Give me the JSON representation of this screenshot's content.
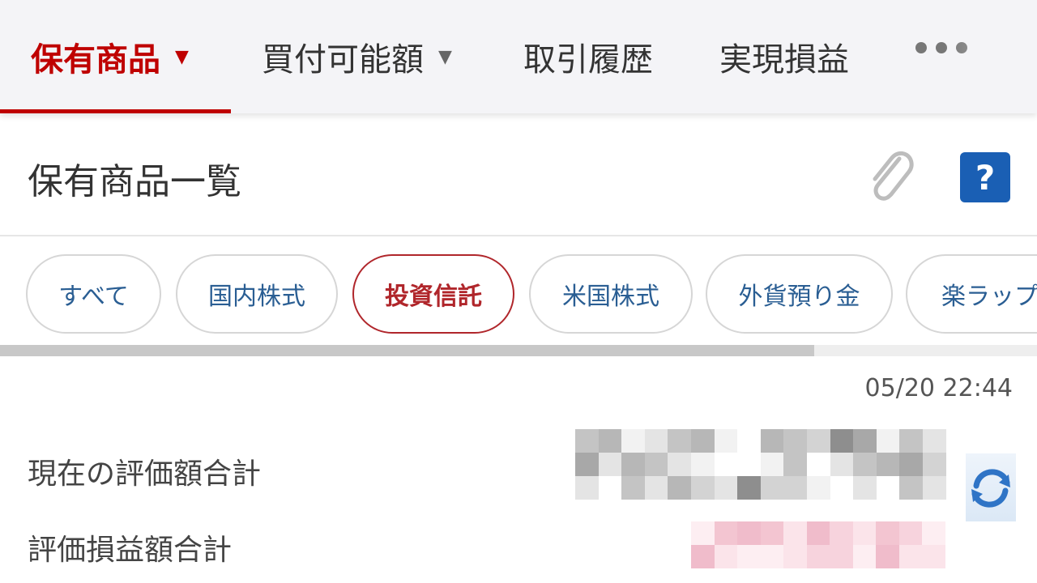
{
  "top_tabs": [
    {
      "label": "保有商品",
      "has_caret": true,
      "active": true
    },
    {
      "label": "買付可能額",
      "has_caret": true,
      "active": false
    },
    {
      "label": "取引履歴",
      "has_caret": false,
      "active": false
    },
    {
      "label": "実現損益",
      "has_caret": false,
      "active": false
    }
  ],
  "more_icon": "more-horizontal-icon",
  "caret_glyph": "▼",
  "header": {
    "title": "保有商品一覧",
    "attach_icon": "paperclip-icon",
    "help_label": "?"
  },
  "filters": [
    {
      "label": "すべて",
      "active": false
    },
    {
      "label": "国内株式",
      "active": false
    },
    {
      "label": "投資信託",
      "active": true
    },
    {
      "label": "米国株式",
      "active": false
    },
    {
      "label": "外貨預り金",
      "active": false
    },
    {
      "label": "楽ラップ",
      "active": false
    }
  ],
  "summary": {
    "timestamp": "05/20 22:44",
    "rows": [
      {
        "label": "現在の評価額合計",
        "value_masked": true
      },
      {
        "label": "評価損益額合計",
        "value_masked": true
      }
    ],
    "refresh_icon": "refresh-icon"
  },
  "colors": {
    "accent_red": "#bf0000",
    "chip_text_blue": "#2a5e93",
    "help_blue": "#1a5fb4",
    "refresh_blue": "#2f74c6"
  }
}
